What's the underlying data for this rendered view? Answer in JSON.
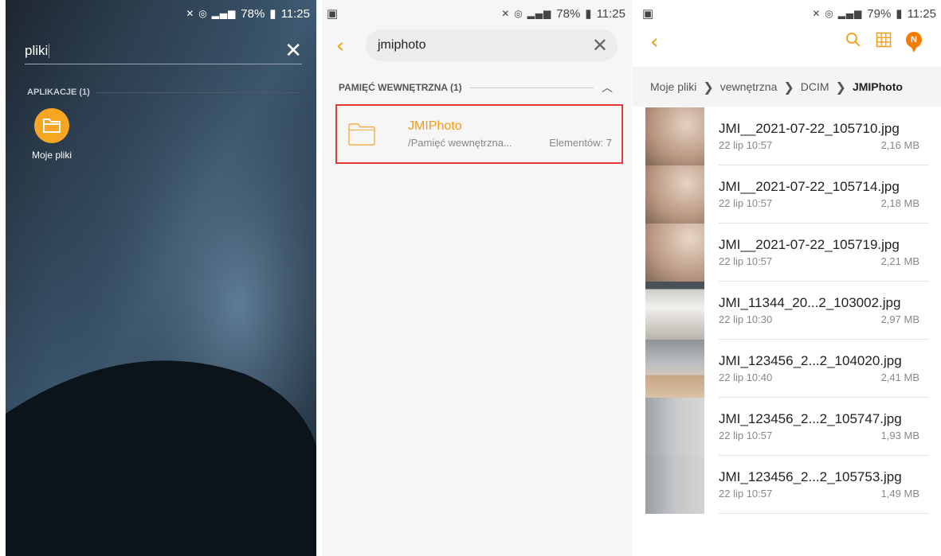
{
  "panel1": {
    "status": {
      "battery": "78%",
      "time": "11:25"
    },
    "search": {
      "query": "pliki"
    },
    "section_title": "APLIKACJE (1)",
    "app": {
      "label": "Moje pliki",
      "icon": "folder-icon"
    }
  },
  "panel2": {
    "status": {
      "battery": "78%",
      "time": "11:25"
    },
    "search": {
      "query": "jmiphoto"
    },
    "section_title": "PAMIĘĆ WEWNĘTRZNA (1)",
    "result": {
      "name": "JMIPhoto",
      "path": "/Pamięć wewnętrzna...",
      "count": "Elementów: 7"
    }
  },
  "panel3": {
    "status": {
      "battery": "79%",
      "time": "11:25"
    },
    "avatar_letter": "N",
    "breadcrumb": [
      "Moje pliki",
      "vewnętrzna",
      "DCIM",
      "JMIPhoto"
    ],
    "files": [
      {
        "name": "JMI__2021-07-22_105710.jpg",
        "date": "22 lip 10:57",
        "size": "2,16 MB"
      },
      {
        "name": "JMI__2021-07-22_105714.jpg",
        "date": "22 lip 10:57",
        "size": "2,18 MB"
      },
      {
        "name": "JMI__2021-07-22_105719.jpg",
        "date": "22 lip 10:57",
        "size": "2,21 MB"
      },
      {
        "name": "JMI_11344_20...2_103002.jpg",
        "date": "22 lip 10:30",
        "size": "2,97 MB"
      },
      {
        "name": "JMI_123456_2...2_104020.jpg",
        "date": "22 lip 10:40",
        "size": "2,41 MB"
      },
      {
        "name": "JMI_123456_2...2_105747.jpg",
        "date": "22 lip 10:57",
        "size": "1,93 MB"
      },
      {
        "name": "JMI_123456_2...2_105753.jpg",
        "date": "22 lip 10:57",
        "size": "1,49 MB"
      }
    ]
  },
  "colors": {
    "accent": "#f39c12",
    "highlight_border": "#e53935"
  }
}
